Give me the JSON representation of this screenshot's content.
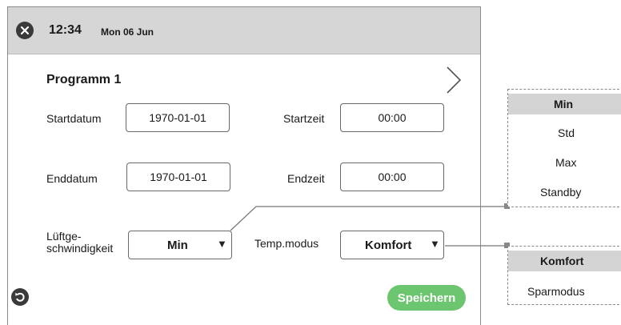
{
  "header": {
    "time": "12:34",
    "date": "Mon 06 Jun",
    "close_icon": "close-icon"
  },
  "program": {
    "title": "Programm 1",
    "next_icon": "chevron-right-icon"
  },
  "form": {
    "start_date_label": "Startdatum",
    "start_date_value": "1970-01-01",
    "start_time_label": "Startzeit",
    "start_time_value": "00:00",
    "end_date_label": "Enddatum",
    "end_date_value": "1970-01-01",
    "end_time_label": "Endzeit",
    "end_time_value": "00:00",
    "fan_speed_label_line1": "Lüftge-",
    "fan_speed_label_line2": "schwindigkeit",
    "fan_speed_value": "Min",
    "temp_mode_label": "Temp.modus",
    "temp_mode_value": "Komfort",
    "caret": "▼"
  },
  "actions": {
    "save_label": "Speichern",
    "back_icon": "back-icon"
  },
  "fan_speed_options": [
    "Min",
    "Std",
    "Max",
    "Standby"
  ],
  "fan_speed_selected_index": 0,
  "temp_mode_options": [
    "Komfort",
    "Sparmodus"
  ],
  "temp_mode_selected_index": 0,
  "colors": {
    "header_bg": "#d6d6d6",
    "save_button": "#6cc56f",
    "selected_option_bg": "#d4d4d4"
  }
}
